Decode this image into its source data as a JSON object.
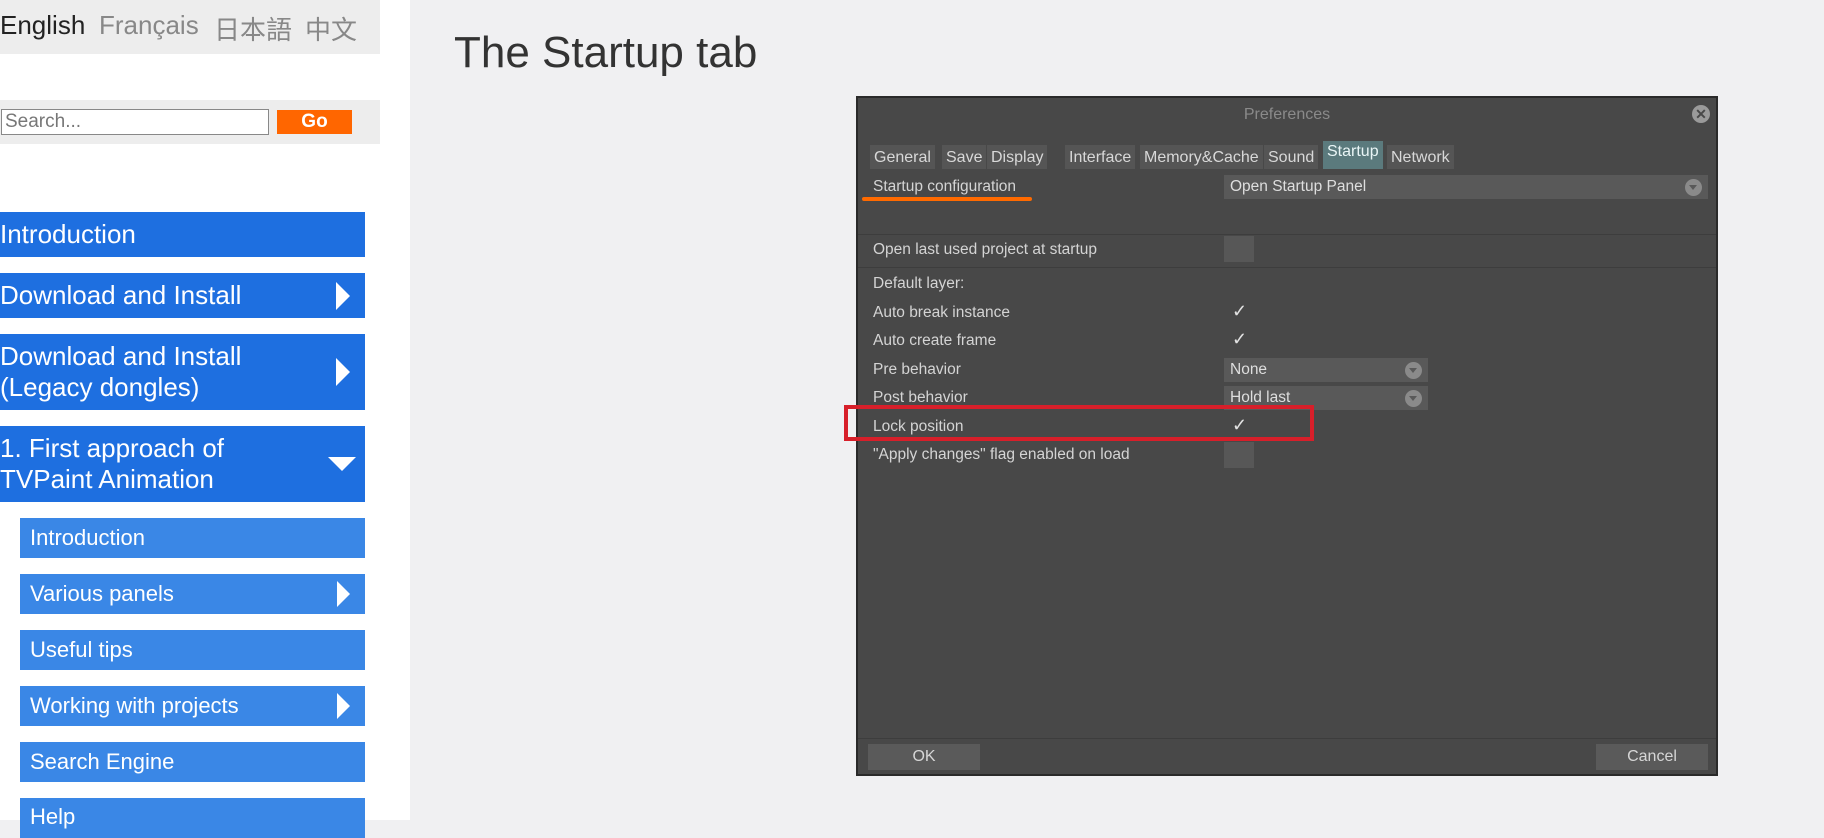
{
  "languages": [
    "English",
    "Français",
    "日本語",
    "中文"
  ],
  "search": {
    "placeholder": "Search...",
    "go_label": "Go"
  },
  "nav": [
    {
      "label": "Introduction"
    },
    {
      "label": "Download and Install"
    },
    {
      "label": "Download and Install (Legacy dongles)",
      "line1": "Download and Install",
      "line2": "(Legacy dongles)"
    },
    {
      "label": "1. First approach of TVPaint Animation",
      "line1": "1. First approach of",
      "line2": "TVPaint Animation"
    }
  ],
  "subnav": [
    "Introduction",
    "Various panels",
    "Useful tips",
    "Working with projects",
    "Search Engine",
    "Help"
  ],
  "page_title": "The Startup tab",
  "dialog": {
    "title": "Preferences",
    "close_icon": "close-circle-icon",
    "tabs": [
      "General",
      "Save",
      "Display",
      "Interface",
      "Memory&Cache",
      "Sound",
      "Startup",
      "Network"
    ],
    "active_tab": "Startup",
    "rows": {
      "startup_config_label": "Startup configuration",
      "startup_config_value": "Open Startup Panel",
      "open_last_label": "Open last used project at startup",
      "default_layer_label": "Default layer:",
      "auto_break_label": "Auto break instance",
      "auto_create_label": "Auto create frame",
      "pre_behavior_label": "Pre behavior",
      "pre_behavior_value": "None",
      "post_behavior_label": "Post behavior",
      "post_behavior_value": "Hold last",
      "lock_position_label": "Lock position",
      "apply_changes_label": "\"Apply changes\" flag enabled on load"
    },
    "check_glyph": "✓",
    "ok_label": "OK",
    "cancel_label": "Cancel"
  },
  "colors": {
    "nav_blue": "#1e6fe0",
    "sub_blue": "#3a87e6",
    "go_orange": "#ff6600",
    "highlight_red": "#d71f2a"
  }
}
